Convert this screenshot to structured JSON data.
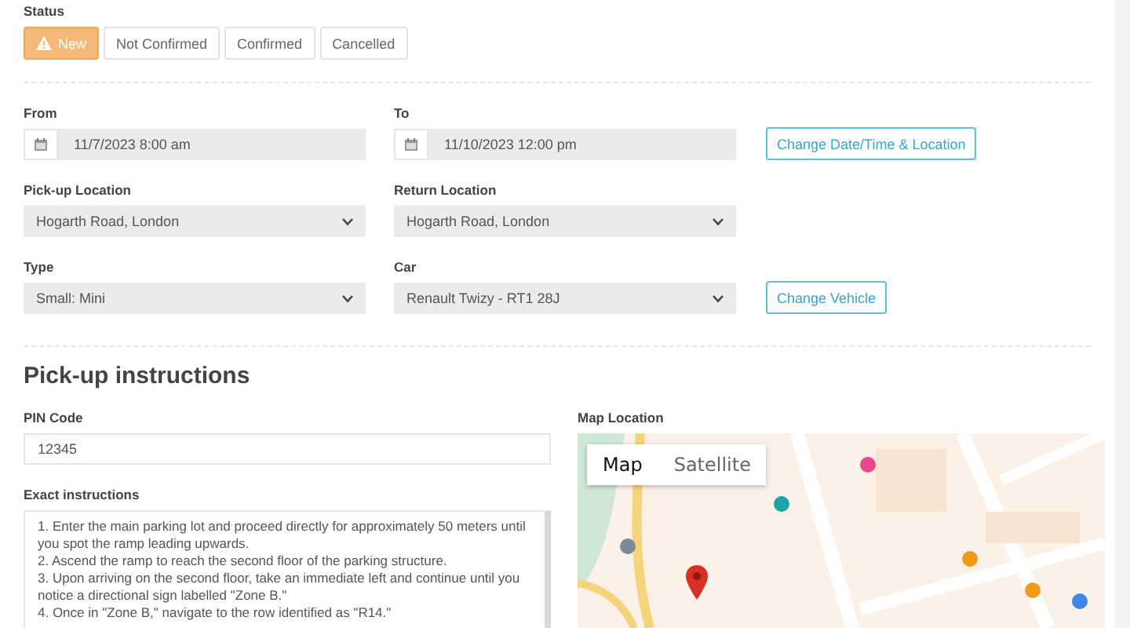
{
  "status": {
    "label": "Status",
    "options": [
      {
        "label": "New",
        "selected": true
      },
      {
        "label": "Not Confirmed",
        "selected": false
      },
      {
        "label": "Confirmed",
        "selected": false
      },
      {
        "label": "Cancelled",
        "selected": false
      }
    ]
  },
  "booking": {
    "rows": [
      {
        "fields": [
          {
            "kind": "date",
            "label": "From",
            "value": "11/7/2023 8:00 am"
          },
          {
            "kind": "date",
            "label": "To",
            "value": "11/10/2023 12:00 pm"
          }
        ],
        "button": "Change Date/Time & Location"
      },
      {
        "fields": [
          {
            "kind": "select",
            "label": "Pick-up Location",
            "value": "Hogarth Road, London"
          },
          {
            "kind": "select",
            "label": "Return Location",
            "value": "Hogarth Road, London"
          }
        ]
      },
      {
        "fields": [
          {
            "kind": "select",
            "label": "Type",
            "value": "Small: Mini"
          },
          {
            "kind": "select",
            "label": "Car",
            "value": "Renault Twizy - RT1 28J"
          }
        ],
        "button": "Change Vehicle"
      }
    ]
  },
  "pickup": {
    "title": "Pick-up instructions",
    "pin": {
      "label": "PIN Code",
      "value": "12345"
    },
    "instructions": {
      "label": "Exact instructions",
      "value": "1. Enter the main parking lot and proceed directly for approximately 50 meters until you spot the ramp leading upwards.\n2. Ascend the ramp to reach the second floor of the parking structure.\n3. Upon arriving on the second floor, take an immediate left and continue until you notice a directional sign labelled \"Zone B.\"\n4. Once in \"Zone B,\" navigate to the row identified as \"R14.\""
    },
    "map": {
      "label": "Map Location",
      "types": [
        {
          "label": "Map",
          "selected": true
        },
        {
          "label": "Satellite",
          "selected": false
        }
      ]
    }
  }
}
